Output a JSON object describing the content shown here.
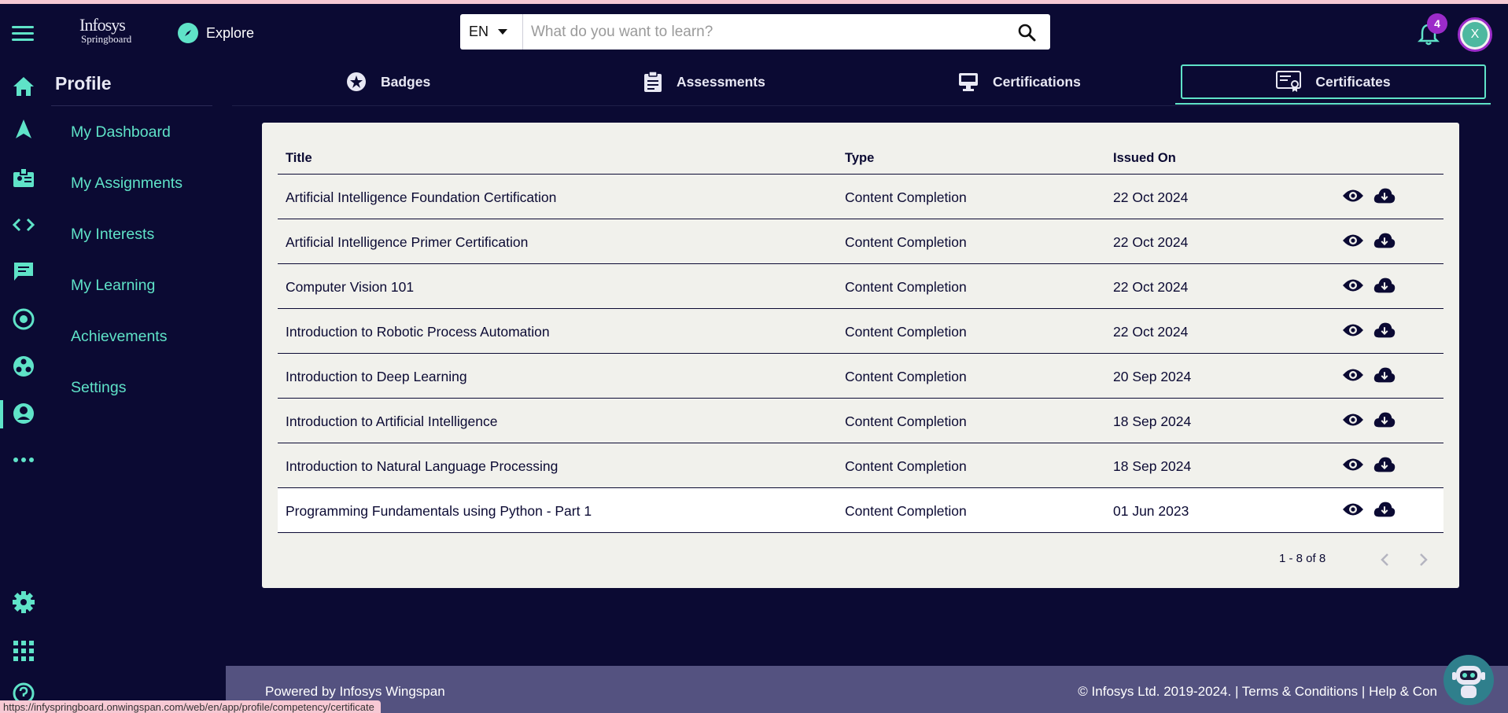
{
  "header": {
    "logo_line1": "Infosys",
    "logo_line2": "Springboard",
    "explore_label": "Explore",
    "lang": "EN",
    "search_placeholder": "What do you want to learn?",
    "notification_count": "4",
    "avatar_initial": "X"
  },
  "rail": {
    "icons": [
      "home-icon",
      "navigate-icon",
      "badge-icon",
      "code-icon",
      "chat-icon",
      "target-icon",
      "community-icon",
      "profile-icon",
      "more-icon",
      "settings-icon",
      "apps-icon",
      "help-icon"
    ],
    "active": "profile-icon"
  },
  "sidebar": {
    "title": "Profile",
    "items": [
      {
        "label": "My Dashboard"
      },
      {
        "label": "My Assignments"
      },
      {
        "label": "My Interests"
      },
      {
        "label": "My Learning"
      },
      {
        "label": "Achievements"
      },
      {
        "label": "Settings"
      }
    ]
  },
  "tabs": [
    {
      "label": "Badges",
      "icon": "star-badge-icon"
    },
    {
      "label": "Assessments",
      "icon": "clipboard-icon"
    },
    {
      "label": "Certifications",
      "icon": "monitor-icon"
    },
    {
      "label": "Certificates",
      "icon": "certificate-icon",
      "active": true
    }
  ],
  "table": {
    "headers": [
      "Title",
      "Type",
      "Issued On"
    ],
    "rows": [
      {
        "title": "Artificial Intelligence Foundation Certification",
        "type": "Content Completion",
        "issued": "22 Oct 2024"
      },
      {
        "title": "Artificial Intelligence Primer Certification",
        "type": "Content Completion",
        "issued": "22 Oct 2024"
      },
      {
        "title": "Computer Vision 101",
        "type": "Content Completion",
        "issued": "22 Oct 2024"
      },
      {
        "title": "Introduction to Robotic Process Automation",
        "type": "Content Completion",
        "issued": "22 Oct 2024"
      },
      {
        "title": "Introduction to Deep Learning",
        "type": "Content Completion",
        "issued": "20 Sep 2024"
      },
      {
        "title": "Introduction to Artificial Intelligence",
        "type": "Content Completion",
        "issued": "18 Sep 2024"
      },
      {
        "title": "Introduction to Natural Language Processing",
        "type": "Content Completion",
        "issued": "18 Sep 2024"
      },
      {
        "title": "Programming Fundamentals using Python - Part 1",
        "type": "Content Completion",
        "issued": "01 Jun 2023"
      }
    ],
    "hovered_row": 7,
    "row_actions": [
      "view-icon",
      "download-icon"
    ],
    "pagination": "1 - 8 of 8"
  },
  "footer": {
    "powered_by": "Powered by Infosys Wingspan",
    "copyright": "© Infosys Ltd. 2019-2024.",
    "sep": " | ",
    "terms": "Terms & Conditions",
    "help": "Help & Con"
  },
  "status_url": "https://infyspringboard.onwingspan.com/web/en/app/profile/competency/certificate",
  "colors": {
    "background": "#0b0a33",
    "accent": "#5fe3c8",
    "card": "#f1f1ec",
    "footer": "#545280",
    "badge": "#9b2bc9"
  }
}
